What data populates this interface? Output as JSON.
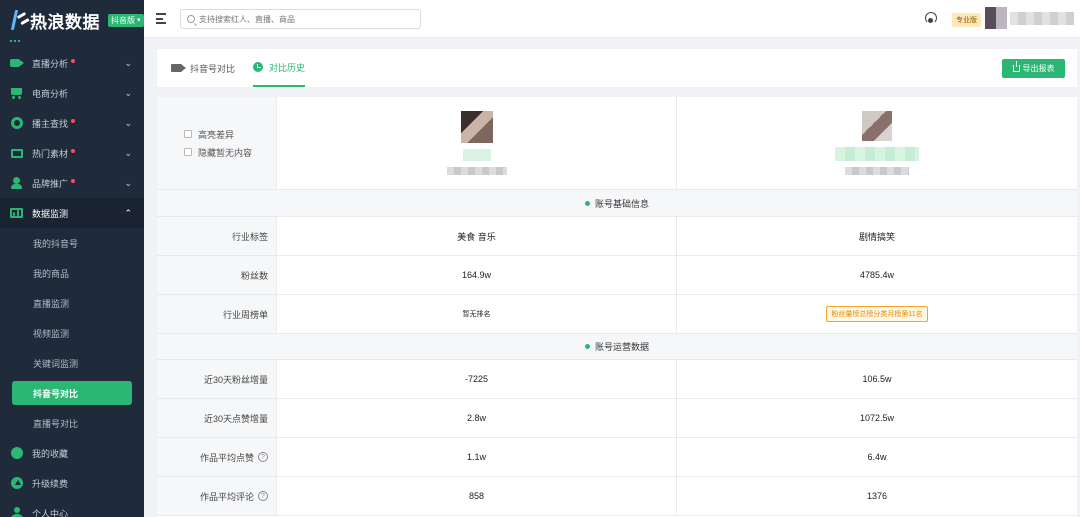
{
  "app": {
    "logo_text": "热浪数据",
    "edition": "抖音版"
  },
  "sidebar": {
    "items": [
      {
        "label": "直播分析",
        "dot": true
      },
      {
        "label": "电商分析",
        "dot": false
      },
      {
        "label": "播主查找",
        "dot": true
      },
      {
        "label": "热门素材",
        "dot": true
      },
      {
        "label": "品牌推广",
        "dot": true
      },
      {
        "label": "数据监测",
        "dot": false
      }
    ],
    "sub_items": [
      "我的抖音号",
      "我的商品",
      "直播监测",
      "视频监测",
      "关键词监测",
      "抖音号对比",
      "直播号对比"
    ],
    "bottom_items": [
      "我的收藏",
      "升级续费",
      "个人中心"
    ]
  },
  "topbar": {
    "search_placeholder": "支持搜索红人、直播、商品",
    "badge": "专业版"
  },
  "tabs": {
    "tab1": "抖音号对比",
    "tab2": "对比历史",
    "export": "导出报表"
  },
  "compare": {
    "options": [
      "高亮差异",
      "隐藏暂无内容"
    ],
    "sections": {
      "basic": "账号基础信息",
      "ops": "账号运营数据"
    },
    "basic_rows": [
      {
        "label": "行业标签",
        "a": "美食 音乐",
        "b": "剧情搞笑"
      },
      {
        "label": "粉丝数",
        "a": "164.9w",
        "b": "4785.4w"
      },
      {
        "label": "行业周榜单",
        "a": "暂无排名",
        "b": "粉丝量榜总榜分类月榜第11名"
      }
    ],
    "ops_rows": [
      {
        "label": "近30天粉丝增量",
        "a": "-7225",
        "b": "106.5w"
      },
      {
        "label": "近30天点赞增量",
        "a": "2.8w",
        "b": "1072.5w"
      },
      {
        "label": "作品平均点赞",
        "a": "1.1w",
        "b": "6.4w"
      },
      {
        "label": "作品平均评论",
        "a": "858",
        "b": "1376"
      }
    ],
    "help_glyph": "?"
  }
}
